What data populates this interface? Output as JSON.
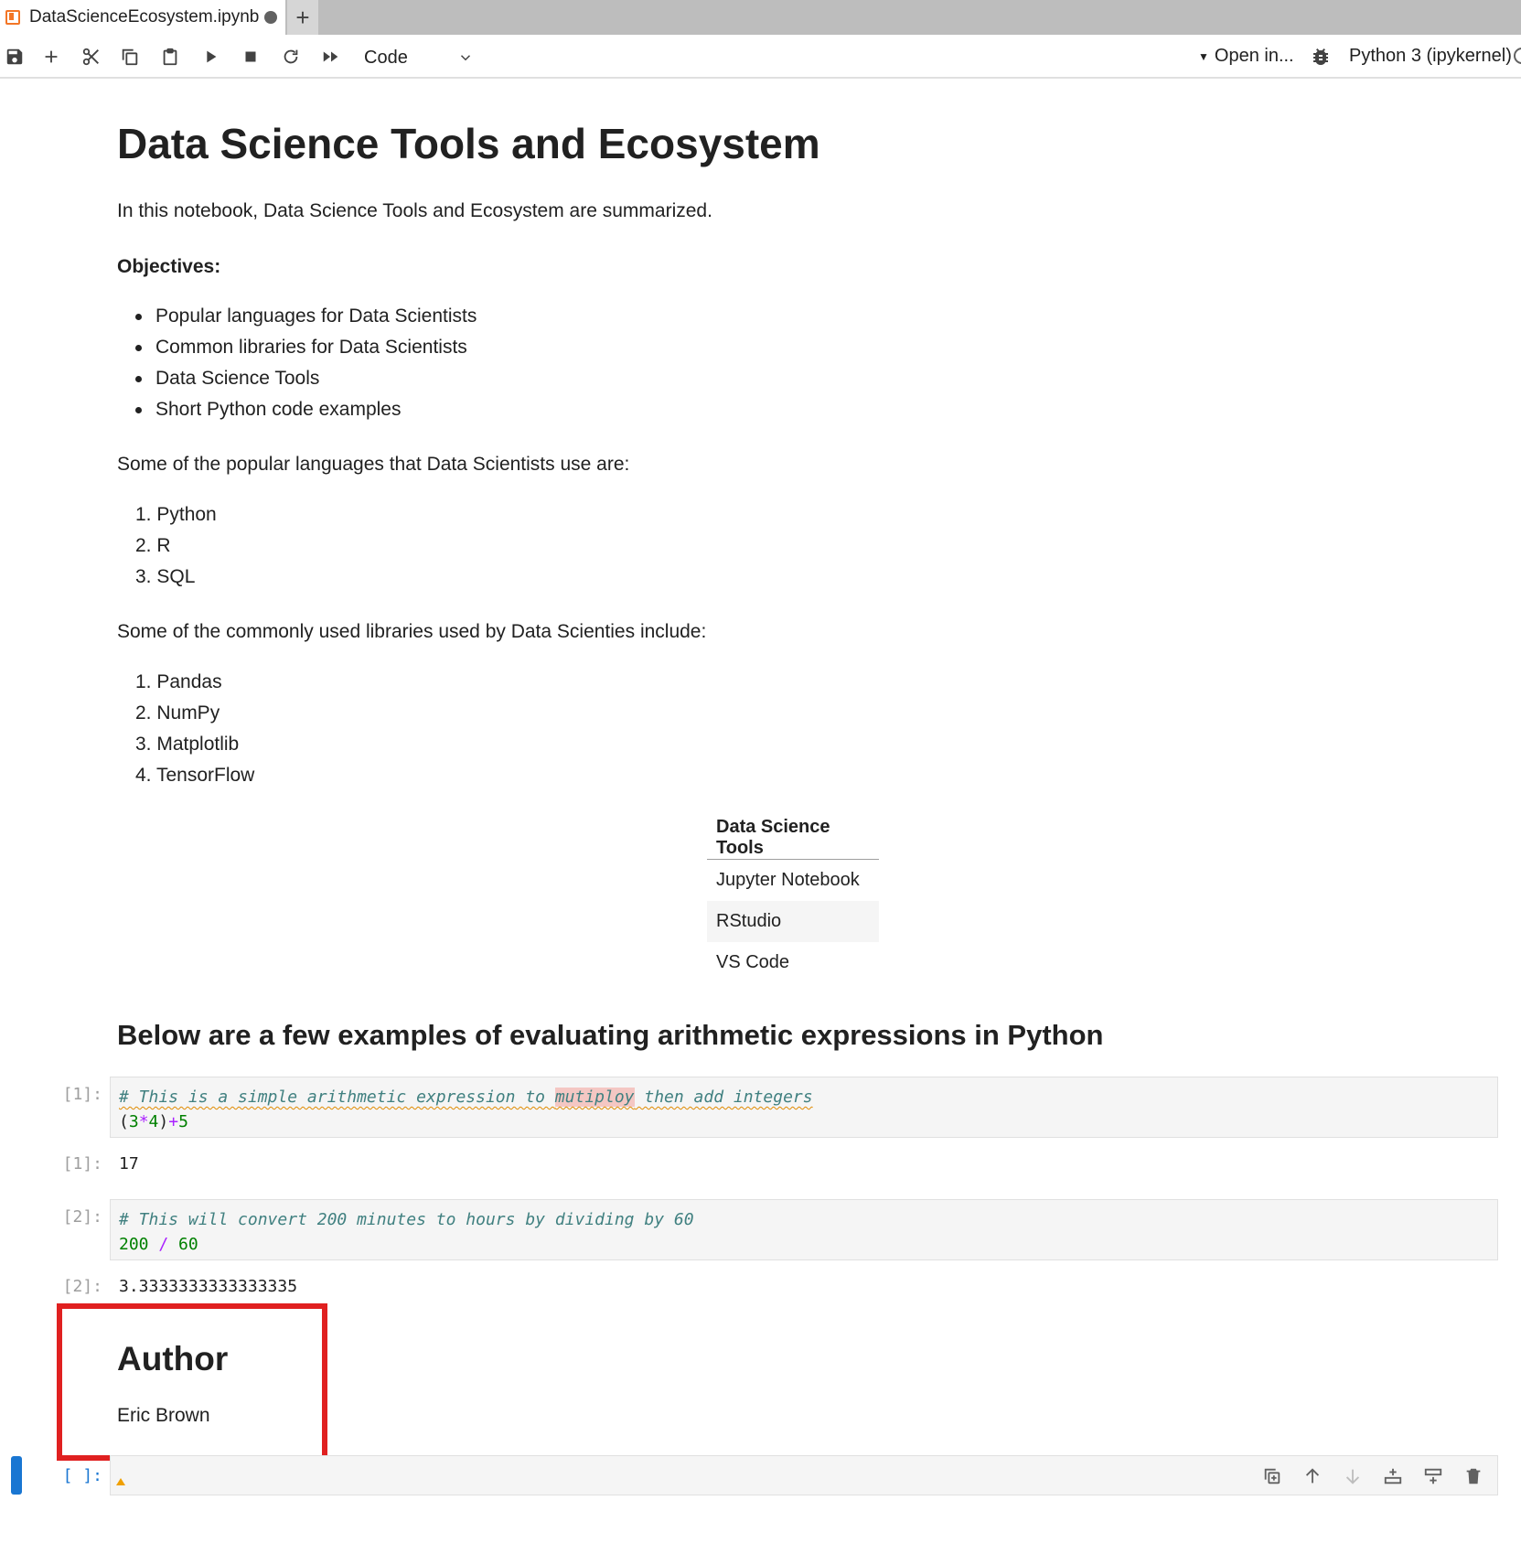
{
  "tab": {
    "title": "DataScienceEcosystem.ipynb",
    "add_label": "+"
  },
  "toolbar": {
    "cell_type": "Code",
    "open_in": "Open in...",
    "kernel": "Python 3 (ipykernel)"
  },
  "notebook": {
    "title": "Data Science Tools and Ecosystem",
    "intro": "In this notebook, Data Science Tools and Ecosystem are summarized.",
    "objectives_label": "Objectives:",
    "objectives": [
      "Popular languages for Data Scientists",
      "Common libraries for Data Scientists",
      "Data Science Tools",
      "Short Python code examples"
    ],
    "languages_intro": "Some of the popular languages that Data Scientists use are:",
    "languages": [
      "1. Python",
      "2. R",
      "3. SQL"
    ],
    "libraries_intro": "Some of the commonly used libraries used by Data Scienties include:",
    "libraries": [
      "1. Pandas",
      "2. NumPy",
      "3. Matplotlib",
      "4. TensorFlow"
    ],
    "tools_table": {
      "header": "Data Science Tools",
      "rows": [
        "Jupyter Notebook",
        "RStudio",
        "VS Code"
      ]
    },
    "arith_heading": "Below are a few examples of evaluating arithmetic expressions in Python",
    "cells": [
      {
        "in_prompt": "[1]:",
        "comment_parts": [
          "# This is a simple arithmetic expression to ",
          "mutiploy",
          " then add integers"
        ],
        "code_parts": [
          "(",
          "3",
          "*",
          "4",
          ")",
          "+",
          "5"
        ],
        "out_prompt": "[1]:",
        "output": "17"
      },
      {
        "in_prompt": "[2]:",
        "comment_parts": [
          "# This will convert 200 minutes to hours by dividing by 60"
        ],
        "code_parts": [
          "200",
          " / ",
          "60"
        ],
        "out_prompt": "[2]:",
        "output": "3.3333333333333335"
      }
    ],
    "author_heading": "Author",
    "author_name": "Eric Brown",
    "empty_prompt": "[ ]:"
  },
  "colors": {
    "accent": "#1976d2",
    "highlight_box": "#e02020",
    "comment": "#408080",
    "number": "#008000",
    "operator": "#aa22ff"
  },
  "icons": {
    "toolbar": [
      "save-icon",
      "add-cell-icon",
      "cut-icon",
      "copy-icon",
      "paste-icon",
      "run-icon",
      "stop-icon",
      "restart-icon",
      "run-all-icon",
      "chevron-down-icon",
      "bug-icon"
    ],
    "cell_tools": [
      "duplicate-cell-icon",
      "move-up-icon",
      "move-down-icon",
      "insert-above-icon",
      "insert-below-icon",
      "delete-icon"
    ]
  }
}
